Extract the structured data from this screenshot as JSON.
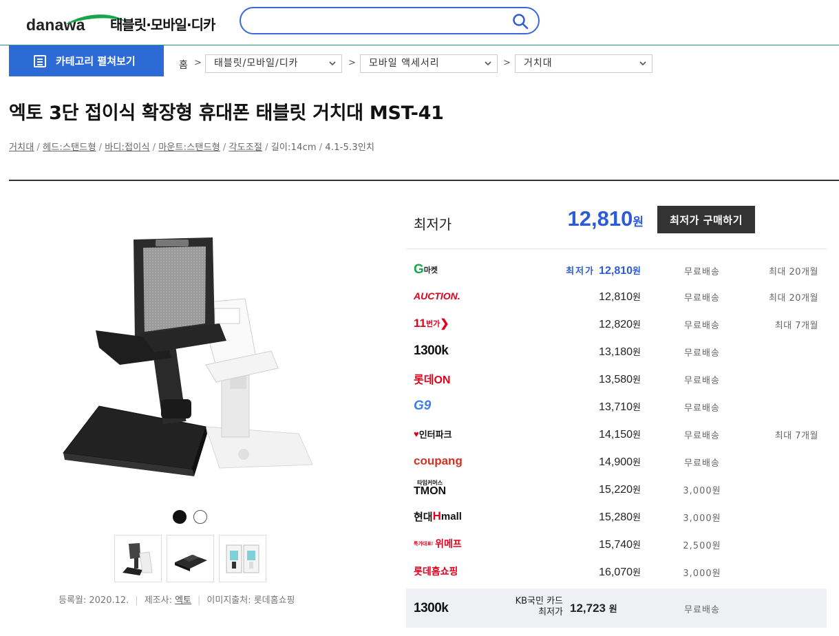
{
  "header": {
    "logo": "danawa",
    "category_title": "태블릿·모바일·디카",
    "search_placeholder": ""
  },
  "nav": {
    "category_button": "카테고리 펼쳐보기",
    "home": "홈",
    "breadcrumbs": [
      "태블릿/모바일/디카",
      "모바일 액세서리",
      "거치대"
    ],
    "sep": ">"
  },
  "product": {
    "title": "엑토 3단 접이식 확장형 휴대폰 태블릿 거치대 MST-41",
    "spec_links": [
      "거치대",
      "헤드:스탠드형",
      "바디:접이식",
      "마운트:스탠드형",
      "각도조절"
    ],
    "spec_plain": [
      "길이:14cm",
      "4.1-5.3인치"
    ],
    "spec_sep": "/",
    "meta": {
      "registered": "등록월: 2020.12.",
      "maker_label": "제조사:",
      "maker": "엑토",
      "image_source": "이미지출처: 롯데홈쇼핑"
    }
  },
  "pricing": {
    "best_label": "최저가",
    "best_price": "12,810",
    "won": "원",
    "buy_button": "최저가 구매하기",
    "lowest_tag": "최저가",
    "accent_color": "#2c5bd6",
    "offers": [
      {
        "mall": "G마켓",
        "price": "12,810",
        "ship": "무료배송",
        "inst": "최대 20개월",
        "lowest": true
      },
      {
        "mall": "AUCTION.",
        "price": "12,810",
        "ship": "무료배송",
        "inst": "최대 20개월",
        "lowest": false
      },
      {
        "mall": "11번가",
        "price": "12,820",
        "ship": "무료배송",
        "inst": "최대 7개월",
        "lowest": false
      },
      {
        "mall": "1300k",
        "price": "13,180",
        "ship": "무료배송",
        "inst": "",
        "lowest": false
      },
      {
        "mall": "롯데ON",
        "price": "13,580",
        "ship": "무료배송",
        "inst": "",
        "lowest": false
      },
      {
        "mall": "G9",
        "price": "13,710",
        "ship": "무료배송",
        "inst": "",
        "lowest": false
      },
      {
        "mall": "인터파크",
        "price": "14,150",
        "ship": "무료배송",
        "inst": "최대 7개월",
        "lowest": false
      },
      {
        "mall": "coupang",
        "price": "14,900",
        "ship": "무료배송",
        "inst": "",
        "lowest": false
      },
      {
        "mall": "TMON",
        "price": "15,220",
        "ship": "3,000원",
        "inst": "",
        "lowest": false
      },
      {
        "mall": "현대Hmall",
        "price": "15,280",
        "ship": "3,000원",
        "inst": "",
        "lowest": false
      },
      {
        "mall": "위메프",
        "price": "15,740",
        "ship": "2,500원",
        "inst": "",
        "lowest": false
      },
      {
        "mall": "롯데홈쇼핑",
        "price": "16,070",
        "ship": "3,000원",
        "inst": "",
        "lowest": false
      }
    ],
    "card_offer": {
      "mall": "1300k",
      "label": "KB국민 카드최저가",
      "price": "12,723",
      "ship": "무료배송"
    }
  }
}
